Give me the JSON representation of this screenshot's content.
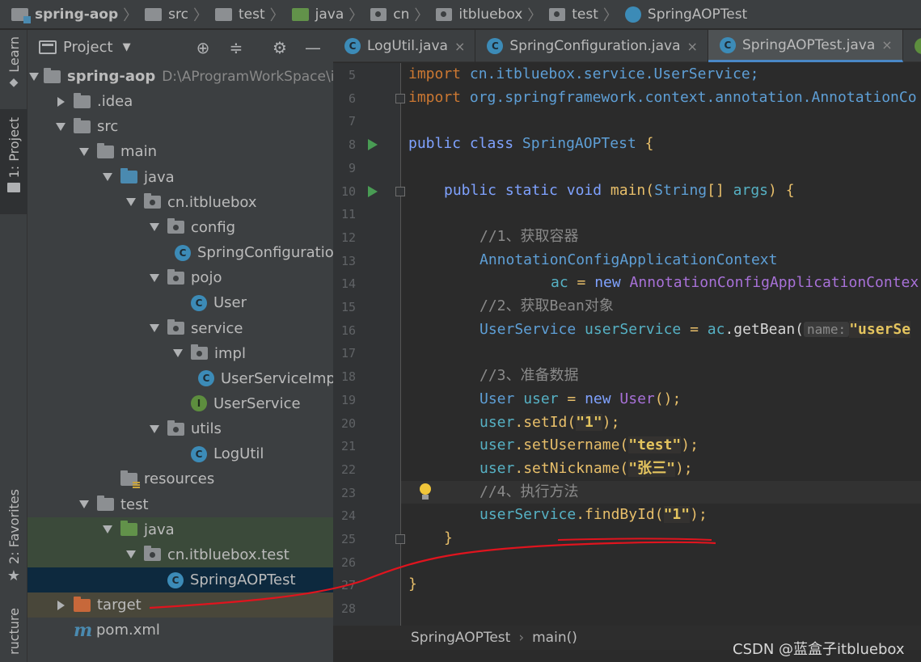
{
  "navbar": {
    "crumbs": [
      {
        "label": "spring-aop",
        "icon": "module-folder-icon"
      },
      {
        "label": "src",
        "icon": "folder-icon"
      },
      {
        "label": "test",
        "icon": "folder-icon"
      },
      {
        "label": "java",
        "icon": "test-source-folder-icon"
      },
      {
        "label": "cn",
        "icon": "package-icon"
      },
      {
        "label": "itbluebox",
        "icon": "package-icon"
      },
      {
        "label": "test",
        "icon": "package-icon"
      },
      {
        "label": "SpringAOPTest",
        "icon": "class-icon"
      }
    ]
  },
  "left_strip": {
    "learn": "Learn",
    "project": "1: Project",
    "favorites": "2: Favorites",
    "structure": "ructure"
  },
  "project_panel": {
    "title": "Project",
    "tree": [
      {
        "label": "spring-aop",
        "path": "D:\\AProgramWorkSpace\\idea\\s",
        "indent": 0,
        "arrow": "open",
        "icon": "module"
      },
      {
        "label": ".idea",
        "indent": 1,
        "arrow": "closed",
        "icon": "gray"
      },
      {
        "label": "src",
        "indent": 1,
        "arrow": "open",
        "icon": "gray"
      },
      {
        "label": "main",
        "indent": 2,
        "arrow": "open",
        "icon": "gray"
      },
      {
        "label": "java",
        "indent": 3,
        "arrow": "open",
        "icon": "blue"
      },
      {
        "label": "cn.itbluebox",
        "indent": 4,
        "arrow": "open",
        "icon": "pkg"
      },
      {
        "label": "config",
        "indent": 5,
        "arrow": "open",
        "icon": "pkg"
      },
      {
        "label": "SpringConfiguration",
        "indent": 6,
        "arrow": "none",
        "icon": "class"
      },
      {
        "label": "pojo",
        "indent": 5,
        "arrow": "open",
        "icon": "pkg"
      },
      {
        "label": "User",
        "indent": 6,
        "arrow": "none",
        "icon": "class"
      },
      {
        "label": "service",
        "indent": 5,
        "arrow": "open",
        "icon": "pkg"
      },
      {
        "label": "impl",
        "indent": 6,
        "arrow": "open",
        "icon": "pkg"
      },
      {
        "label": "UserServiceImpl",
        "indent": 7,
        "arrow": "none",
        "icon": "class"
      },
      {
        "label": "UserService",
        "indent": 6,
        "arrow": "none",
        "icon": "iface"
      },
      {
        "label": "utils",
        "indent": 5,
        "arrow": "open",
        "icon": "pkg"
      },
      {
        "label": "LogUtil",
        "indent": 6,
        "arrow": "none",
        "icon": "class"
      },
      {
        "label": "resources",
        "indent": 3,
        "arrow": "none",
        "icon": "res"
      },
      {
        "label": "test",
        "indent": 2,
        "arrow": "open",
        "icon": "gray"
      },
      {
        "label": "java",
        "indent": 3,
        "arrow": "open",
        "icon": "green",
        "sel": "green"
      },
      {
        "label": "cn.itbluebox.test",
        "indent": 4,
        "arrow": "open",
        "icon": "pkg",
        "sel": "green"
      },
      {
        "label": "SpringAOPTest",
        "indent": 5,
        "arrow": "none",
        "icon": "class",
        "sel": "blue"
      },
      {
        "label": "target",
        "indent": 1,
        "arrow": "closed",
        "icon": "orange",
        "sel": "olive"
      },
      {
        "label": "pom.xml",
        "indent": 1,
        "arrow": "none",
        "icon": "maven"
      }
    ]
  },
  "editor": {
    "tabs": [
      {
        "label": "LogUtil.java",
        "close": "×",
        "active": false
      },
      {
        "label": "SpringConfiguration.java",
        "close": "×",
        "active": false
      },
      {
        "label": "SpringAOPTest.java",
        "close": "×",
        "active": true
      }
    ],
    "line_numbers": [
      "5",
      "6",
      "7",
      "8",
      "9",
      "10",
      "11",
      "12",
      "13",
      "14",
      "15",
      "16",
      "17",
      "18",
      "19",
      "20",
      "21",
      "22",
      "23",
      "24",
      "25",
      "26",
      "27",
      "28"
    ],
    "code": {
      "l5": {
        "kw": "import",
        "rest": " cn.itbluebox.service.UserService;"
      },
      "l6": {
        "kw": "import",
        "rest": " org.springframework.context.annotation.AnnotationCo"
      },
      "l8": {
        "kw1": "public",
        "kw2": " class",
        "name": " SpringAOPTest",
        "brace": " {"
      },
      "l10": {
        "kw1": "public",
        "kw2": " static",
        "kw3": " void",
        "name": " main",
        "p1": "(",
        "type": "String",
        "arr": "[]",
        "arg": " args",
        "p2": ") {"
      },
      "l12": "//1、获取容器",
      "l13": "AnnotationConfigApplicationContext",
      "l14": {
        "var": "ac",
        "eq": " = ",
        "kw": "new",
        "cls": " AnnotationConfigApplicationContex"
      },
      "l15": "//2、获取Bean对象",
      "l16": {
        "type": "UserService",
        "var": " userService",
        "eq": " = ",
        "obj": "ac",
        "call": ".getBean(",
        "hint": "name:",
        "str": "\"userSe"
      },
      "l18": "//3、准备数据",
      "l19": {
        "type": "User",
        "var": " user",
        "eq": " = ",
        "kw": "new",
        "cls": " User",
        "end": "();"
      },
      "l20": {
        "obj": "user",
        "call": ".setId(",
        "str": "\"1\"",
        "end": ");"
      },
      "l21": {
        "obj": "user",
        "call": ".setUsername(",
        "str": "\"test\"",
        "end": ");"
      },
      "l22": {
        "obj": "user",
        "call": ".setNickname(",
        "str": "\"张三\"",
        "end": ");"
      },
      "l23": "//4、执行方法",
      "l24": {
        "obj": "userService",
        "call": ".findById(",
        "str": "\"1\"",
        "end": ");"
      },
      "l25": "}",
      "l27": "}"
    },
    "breadcrumb": {
      "cls": "SpringAOPTest",
      "sep": "›",
      "method": "main()"
    }
  },
  "watermark": "CSDN @蓝盒子itbluebox",
  "colors": {
    "accent": "#4a88c7",
    "run_green": "#499c54",
    "annotation_red": "#e0141e"
  }
}
